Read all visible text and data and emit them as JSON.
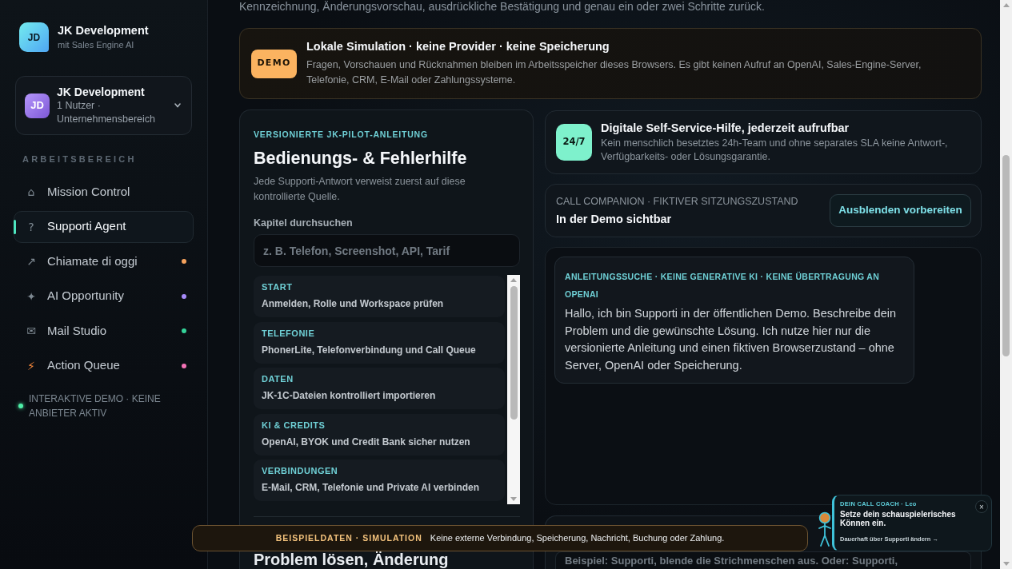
{
  "page": {
    "intro_tail": "Kennzeichnung, Änderungsvorschau, ausdrückliche Bestätigung und genau ein oder zwei Schritte zurück."
  },
  "sidebar": {
    "brand": {
      "logo": "JD",
      "title": "JK Development",
      "subtitle": "mit Sales Engine AI"
    },
    "workspace": {
      "avatar": "JD",
      "name": "JK Development",
      "meta": "1 Nutzer · Unternehmensbereich"
    },
    "section_label": "ARBEITSBEREICH",
    "items": [
      {
        "icon": "⌂",
        "label": "Mission Control",
        "selected": false
      },
      {
        "icon": "?",
        "label": "Supporti Agent",
        "selected": true
      },
      {
        "icon": "↗",
        "label": "Chiamate di oggi",
        "selected": false,
        "color": "#f5a25d"
      },
      {
        "icon": "✦",
        "label": "AI Opportunity",
        "selected": false,
        "color": "#a78bfa"
      },
      {
        "icon": "✉",
        "label": "Mail Studio",
        "selected": false,
        "color": "#34d399"
      },
      {
        "icon": "⚡",
        "label": "Action Queue",
        "selected": false,
        "color": "#f472b6"
      }
    ],
    "status": "INTERAKTIVE DEMO · KEINE ANBIETER AKTIV"
  },
  "demo_notice": {
    "badge": "DEMO",
    "title": "Lokale Simulation · keine Provider · keine Speicherung",
    "text": "Fragen, Vorschauen und Rücknahmen bleiben im Arbeitsspeicher dieses Browsers. Es gibt keinen Aufruf an OpenAI, Sales-Engine-Server, Telefonie, CRM, E-Mail oder Zahlungssysteme."
  },
  "guide_panel": {
    "eyebrow": "VERSIONIERTE JK-PILOT-ANLEITUNG",
    "title": "Bedienungs- & Fehlerhilfe",
    "description": "Jede Supporti-Antwort verweist zuerst auf diese kontrollierte Quelle.",
    "search": {
      "label": "Kapitel durchsuchen",
      "placeholder": "z. B. Telefon, Screenshot, API, Tarif"
    },
    "chapters": [
      {
        "tag": "START",
        "title": "Anmelden, Rolle und Workspace prüfen"
      },
      {
        "tag": "TELEFONIE",
        "title": "PhonerLite, Telefonverbindung und Call Queue"
      },
      {
        "tag": "DATEN",
        "title": "JK-1C-Dateien kontrolliert importieren"
      },
      {
        "tag": "KI & CREDITS",
        "title": "OpenAI, BYOK und Credit Bank sicher nutzen"
      },
      {
        "tag": "VERBINDUNGEN",
        "title": "E-Mail, CRM, Telefonie und Private AI verbinden"
      }
    ],
    "next_title": "Problem lösen, Änderung"
  },
  "self_service": {
    "badge": "24/7",
    "title": "Digitale Self-Service-Hilfe, jederzeit aufrufbar",
    "text": "Kein menschlich besetztes 24h-Team und ohne separates SLA keine Antwort-, Verfügbarkeits- oder Lösungsgarantie."
  },
  "call_companion": {
    "label": "CALL COMPANION · FIKTIVER SITZUNGSZUSTAND",
    "state": "In der Demo sichtbar",
    "button": "Ausblenden vorbereiten"
  },
  "chat": {
    "messages": [
      {
        "eyebrow": "ANLEITUNGSSUCHE · KEINE GENERATIVE KI · KEINE ÜBERTRAGUNG AN OPENAI",
        "text": "Hallo, ich bin Supporti in der öffentlichen Demo. Beschreibe dein Problem und die gewünschte Lösung. Ich nutze hier nur die versionierte Anleitung und einen fiktiven Browserzustand – ohne Server, OpenAI oder Speicherung."
      }
    ]
  },
  "problem_form": {
    "placeholder": "Beispiel: Supporti, blende die Strichmenschen aus. Oder: Supporti,"
  },
  "simulation_banner": {
    "label": "BEISPIELDATEN · SIMULATION",
    "text": "Keine externe Verbindung, Speicherung, Nachricht, Buchung oder Zahlung."
  },
  "coach_popup": {
    "eyebrow": "DEIN CALL COACH · Leo",
    "title": "Setze dein schauspielerisches Können ein.",
    "link": "Dauerhaft über Supporti ändern →",
    "close": "×"
  }
}
